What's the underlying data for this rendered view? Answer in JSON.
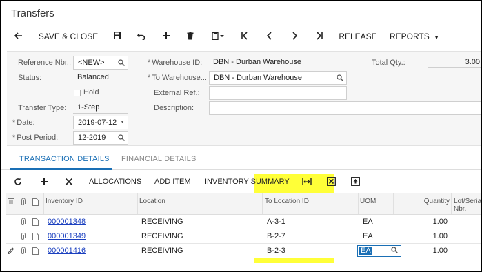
{
  "screen": {
    "title": "Transfers"
  },
  "toolbar": {
    "save_close": "SAVE & CLOSE",
    "release": "RELEASE",
    "reports": "REPORTS"
  },
  "form": {
    "reference_nbr": {
      "label": "Reference Nbr.:",
      "value": "<NEW>"
    },
    "status": {
      "label": "Status:",
      "value": "Balanced"
    },
    "hold": {
      "label": "Hold",
      "checked": false
    },
    "transfer_type": {
      "label": "Transfer Type:",
      "value": "1-Step"
    },
    "date": {
      "label": "Date:",
      "value": "2019-07-12"
    },
    "post_period": {
      "label": "Post Period:",
      "value": "12-2019"
    },
    "warehouse_id": {
      "label": "Warehouse ID:",
      "value": "DBN - Durban Warehouse"
    },
    "to_warehouse": {
      "label": "To Warehouse...",
      "value": "DBN - Durban Warehouse"
    },
    "external_ref": {
      "label": "External Ref.:",
      "value": ""
    },
    "description": {
      "label": "Description:",
      "value": ""
    },
    "total_qty": {
      "label": "Total Qty.:",
      "value": "3.00"
    },
    "required_mark": "*"
  },
  "tabs": [
    {
      "label": "TRANSACTION DETAILS",
      "active": true
    },
    {
      "label": "FINANCIAL DETAILS",
      "active": false
    }
  ],
  "grid_toolbar": {
    "allocations": "ALLOCATIONS",
    "add_item": "ADD ITEM",
    "inventory_summary": "INVENTORY SUMMARY"
  },
  "grid": {
    "columns": {
      "inventory_id": "Inventory ID",
      "location": "Location",
      "to_location_id": "To Location ID",
      "uom": "UOM",
      "quantity": "Quantity",
      "lot_serial_1": "Lot/Seria",
      "lot_serial_2": "Nbr."
    },
    "rows": [
      {
        "inventory_id": "000001348",
        "location": "RECEIVING",
        "to_location_id": "A-3-1",
        "uom": "EA",
        "quantity": "1.00"
      },
      {
        "inventory_id": "000001349",
        "location": "RECEIVING",
        "to_location_id": "B-2-7",
        "uom": "EA",
        "quantity": "1.00"
      },
      {
        "inventory_id": "000001416",
        "location": "RECEIVING",
        "to_location_id": "B-2-3",
        "uom": "EA",
        "quantity": "1.00"
      }
    ]
  },
  "colors": {
    "accent": "#1a6fb5",
    "highlight": "#ffff00",
    "link": "#1a3fbf"
  },
  "icons": [
    "back-arrow-icon",
    "save-icon",
    "undo-icon",
    "add-icon",
    "delete-icon",
    "copy-paste-icon",
    "first-icon",
    "previous-icon",
    "next-icon",
    "last-icon",
    "refresh-icon",
    "close-x-icon",
    "fit-width-icon",
    "export-excel-icon",
    "upload-icon",
    "search-icon",
    "attachment-icon",
    "note-icon",
    "pencil-icon"
  ]
}
